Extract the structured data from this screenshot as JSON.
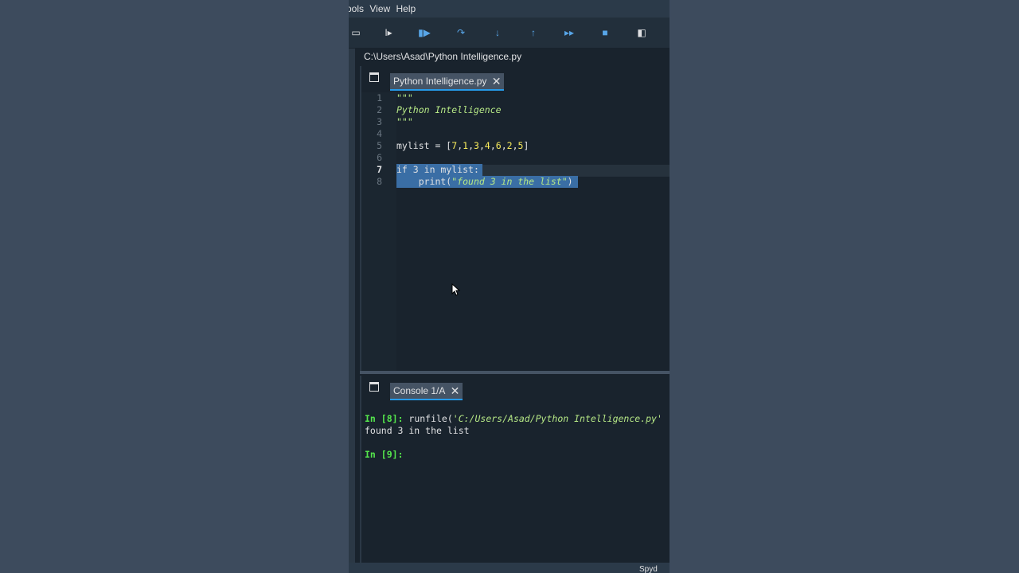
{
  "menubar": {
    "items": [
      "ools",
      "View",
      "Help"
    ]
  },
  "toolbar": {
    "buttons": [
      {
        "name": "run-cell-icon",
        "glyph": "▭"
      },
      {
        "name": "debug-icon",
        "glyph": "I▸"
      },
      {
        "name": "continue-icon",
        "glyph": "▮▶"
      },
      {
        "name": "step-over-icon",
        "glyph": "↷"
      },
      {
        "name": "step-into-icon",
        "glyph": "↓"
      },
      {
        "name": "step-out-icon",
        "glyph": "↑"
      },
      {
        "name": "fast-forward-icon",
        "glyph": "▸▸"
      },
      {
        "name": "stop-icon",
        "glyph": "■"
      },
      {
        "name": "maximize-pane-icon",
        "glyph": "◧"
      }
    ]
  },
  "path": "C:\\Users\\Asad\\Python Intelligence.py",
  "editor": {
    "tab_label": "Python Intelligence.py",
    "close_glyph": "✕",
    "line_numbers": [
      "1",
      "2",
      "3",
      "4",
      "5",
      "6",
      "7",
      "8"
    ],
    "active_line": "7",
    "lines": {
      "l1": "\"\"\"",
      "l2": "Python Intelligence",
      "l3": "\"\"\"",
      "l4": "",
      "l5_a": "mylist = [",
      "l5_b": "7",
      "l5_c": ",",
      "l5_d": "1",
      "l5_e": ",",
      "l5_f": "3",
      "l5_g": ",",
      "l5_h": "4",
      "l5_i": ",",
      "l5_j": "6",
      "l5_k": ",",
      "l5_l": "2",
      "l5_m": ",",
      "l5_n": "5",
      "l5_o": "]",
      "l6": "",
      "l7_a": "if ",
      "l7_b": "3",
      "l7_c": " in mylist:",
      "l8_a": "    print(",
      "l8_b": "\"found 3 in the list\"",
      "l8_c": ")"
    }
  },
  "console": {
    "tab_label": "Console 1/A",
    "close_glyph": "✕",
    "prompt1": "In [8]:",
    "cmd1_a": " runfile(",
    "cmd1_b": "'C:/Users/Asad/Python Intelligence.py'",
    "output1": "found 3 in the list",
    "prompt2": "In [9]:"
  },
  "statusbar": {
    "text": "Spyd"
  },
  "colors": {
    "background": "#19232d",
    "tab_active": "#455364",
    "accent": "#259ae9",
    "string": "#b6e886",
    "number": "#faed5c",
    "prompt": "#54e54c",
    "selection": "#3a6ea5"
  }
}
